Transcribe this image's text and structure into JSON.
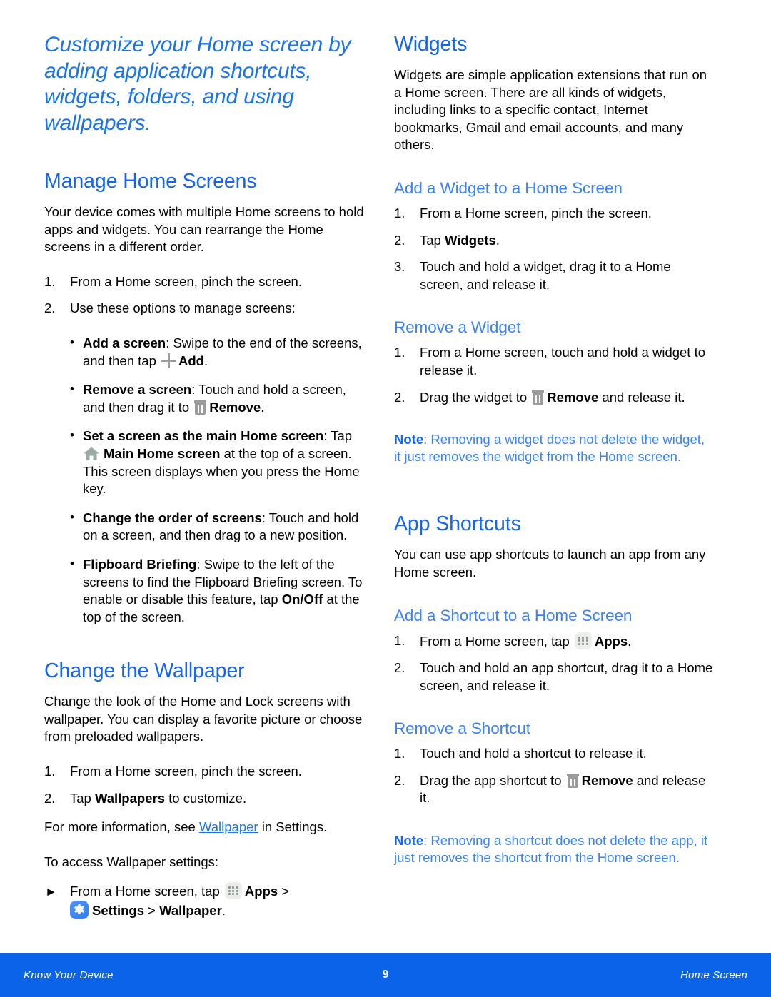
{
  "doc": {
    "title": "Customize your Home screen by adding application shortcuts, widgets, folders, and using wallpapers."
  },
  "colors": {
    "heading_blue": "#1565f0",
    "subheading_blue": "#3b82f6",
    "title_blue": "#1a73e8",
    "link_blue": "#1a73e8",
    "footer_blue": "#0a63e8",
    "icon_gray": "#9b9b9b",
    "home_icon_gray": "#9aaba7",
    "apps_icon_bg": "#eceeec",
    "gear_icon_bg": "#3b82f6"
  },
  "left_column": {
    "manage_home_screens": {
      "heading": "Manage Home Screens",
      "intro": "Your device comes with multiple Home screens to hold apps and widgets. You can rearrange the Home screens in a different order.",
      "steps": [
        {
          "num": "1.",
          "text": "From a Home screen, pinch the screen."
        },
        {
          "num": "2.",
          "text": "Use these options to manage screens:"
        }
      ],
      "bullets": [
        {
          "label": "Add a screen",
          "text_before_icon": ": Swipe to the end of the screens, and then tap ",
          "icon": "plus-icon",
          "icon_label": "Add",
          "text_after_icon": "."
        },
        {
          "label": "Remove a screen",
          "text_before_icon": ": Touch and hold a screen, and then drag it to ",
          "icon": "trash-icon",
          "icon_label": "Remove",
          "text_after_icon": "."
        },
        {
          "label": "Set a screen as the main Home screen",
          "text_before_icon": ": Tap ",
          "icon": "home-icon",
          "icon_label": "Main Home screen",
          "text_after_icon": " at the top of a screen. This screen displays when you press the Home key."
        },
        {
          "label": "Change the order of screens",
          "text_before_icon": ": Touch and hold on a screen, and then drag to a new position.",
          "icon": "",
          "icon_label": "",
          "text_after_icon": ""
        },
        {
          "label": "Flipboard Briefing",
          "text_before_icon": ": Swipe to the left of the screens to find the Flipboard Briefing screen. To enable or disable this feature, tap ",
          "icon": "",
          "icon_label": "On/Off",
          "text_after_icon": " at the top of the screen."
        }
      ]
    },
    "change_the_wallpaper": {
      "heading": "Change the Wallpaper",
      "intro": "Change the look of the Home and Lock screens with wallpaper. You can display a favorite picture or choose from preloaded wallpapers.",
      "steps": [
        {
          "num": "1.",
          "text": "From a Home screen, pinch the screen."
        },
        {
          "num": "2.",
          "text_before_bold": "Tap ",
          "bold": "Wallpapers",
          "text_after_bold": " to customize."
        }
      ],
      "more_info": {
        "before_link": "For more information, see ",
        "link": "Wallpaper",
        "after_link": " in Settings."
      },
      "access_lead": "To access Wallpaper settings:",
      "access_step": {
        "before_apps_icon": "From a Home screen, tap ",
        "apps_label": "Apps",
        "separator_1": " > ",
        "settings_label": "Settings",
        "separator_2": " > ",
        "wallpaper_label": "Wallpaper",
        "period": "."
      }
    }
  },
  "right_column": {
    "widgets": {
      "heading": "Widgets",
      "intro": "Widgets are simple application extensions that run on a Home screen. There are all kinds of widgets, including links to a specific contact, Internet bookmarks, Gmail and email accounts, and many others.",
      "add_widget": {
        "heading": "Add a Widget to a Home Screen",
        "steps": [
          {
            "num": "1.",
            "text": "From a Home screen, pinch the screen."
          },
          {
            "num": "2.",
            "text_before_bold": "Tap ",
            "bold": "Widgets",
            "text_after_bold": "."
          },
          {
            "num": "3.",
            "text": "Touch and hold a widget, drag it to a Home screen, and release it."
          }
        ]
      },
      "remove_widget": {
        "heading": "Remove a Widget",
        "steps": [
          {
            "num": "1.",
            "text": "From a Home screen, touch and hold a widget to release it."
          },
          {
            "num": "2.",
            "text_before_icon": "Drag the widget to ",
            "icon": "trash-icon",
            "icon_label": "Remove",
            "text_after_icon": " and release it."
          }
        ],
        "note": {
          "label": "Note",
          "text": ": Removing a widget does not delete the widget, it just removes the widget from the Home screen."
        }
      }
    },
    "app_shortcuts": {
      "heading": "App Shortcuts",
      "intro": "You can use app shortcuts to launch an app from any Home screen.",
      "add_shortcut": {
        "heading": "Add a Shortcut to a Home Screen",
        "steps": [
          {
            "num": "1.",
            "text_before_icon": "From a Home screen, tap ",
            "icon": "apps-grid-icon",
            "icon_label": "Apps",
            "text_after_icon": "."
          },
          {
            "num": "2.",
            "text": "Touch and hold an app shortcut, drag it to a Home screen, and release it."
          }
        ]
      },
      "remove_shortcut": {
        "heading": "Remove a Shortcut",
        "steps": [
          {
            "num": "1.",
            "text": "Touch and hold a shortcut to release it."
          },
          {
            "num": "2.",
            "text_before_icon": "Drag the app shortcut to ",
            "icon": "trash-icon",
            "icon_label": "Remove",
            "text_after_icon": " and release it."
          }
        ],
        "note": {
          "label": "Note",
          "text": ": Removing a shortcut does not delete the app, it just removes the shortcut from the Home screen."
        }
      }
    }
  },
  "footer": {
    "left": "Know Your Device",
    "page_number": "9",
    "right": "Home Screen"
  }
}
